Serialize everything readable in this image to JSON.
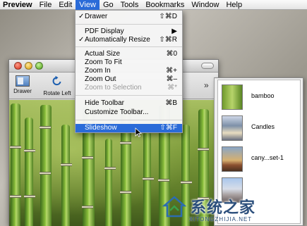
{
  "menubar": {
    "items": [
      {
        "label": "Preview"
      },
      {
        "label": "File"
      },
      {
        "label": "Edit"
      },
      {
        "label": "View"
      },
      {
        "label": "Go"
      },
      {
        "label": "Tools"
      },
      {
        "label": "Bookmarks"
      },
      {
        "label": "Window"
      },
      {
        "label": "Help"
      }
    ],
    "active": "View",
    "active_color": "#2a6bd8"
  },
  "view_menu": {
    "items": [
      {
        "check": "✓",
        "label": "Drawer",
        "shortcut": "⇧⌘D"
      },
      {
        "check": "",
        "label": "PDF Display",
        "shortcut": "▶"
      },
      {
        "check": "✓",
        "label": "Automatically Resize",
        "shortcut": "⇧⌘R"
      },
      {
        "check": "",
        "label": "Actual Size",
        "shortcut": "⌘0"
      },
      {
        "check": "",
        "label": "Zoom To Fit",
        "shortcut": ""
      },
      {
        "check": "",
        "label": "Zoom In",
        "shortcut": "⌘+"
      },
      {
        "check": "",
        "label": "Zoom Out",
        "shortcut": "⌘–"
      },
      {
        "check": "",
        "label": "Zoom to Selection",
        "shortcut": "⌘*"
      },
      {
        "check": "",
        "label": "Hide Toolbar",
        "shortcut": "⌘B"
      },
      {
        "check": "",
        "label": "Customize Toolbar...",
        "shortcut": ""
      },
      {
        "check": "",
        "label": "Slideshow",
        "shortcut": "⇧⌘F"
      }
    ],
    "highlighted": "Slideshow",
    "disabled": [
      "Zoom to Selection"
    ]
  },
  "toolbar": {
    "drawer_label": "Drawer",
    "rotate_label": "Rotate Left",
    "overflow_glyph": "»"
  },
  "drawer": {
    "thumbnails": [
      {
        "label": "bamboo"
      },
      {
        "label": "Candles"
      },
      {
        "label": "cany...set-1"
      },
      {
        "label": ""
      }
    ]
  },
  "watermark": {
    "chinese": "系统之家",
    "english": "XITONGZHIJIA.NET"
  }
}
